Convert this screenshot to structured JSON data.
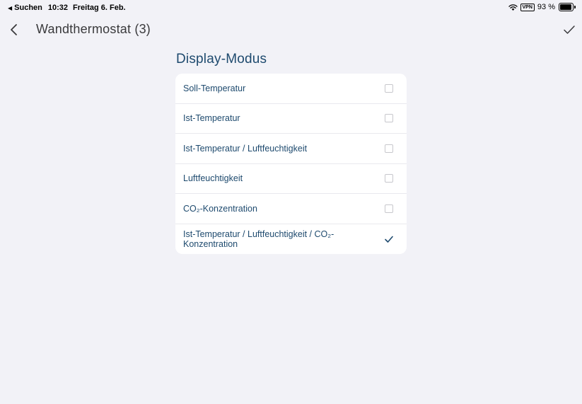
{
  "status_bar": {
    "back_app": "Suchen",
    "time": "10:32",
    "date": "Freitag 6. Feb.",
    "vpn": "VPN",
    "battery_percent": "93 %",
    "battery_level": 0.93
  },
  "nav": {
    "title": "Wandthermostat (3)"
  },
  "section": {
    "title": "Display-Modus"
  },
  "options": [
    {
      "label": "Soll-Temperatur",
      "checked": false
    },
    {
      "label": "Ist-Temperatur",
      "checked": false
    },
    {
      "label": "Ist-Temperatur / Luftfeuchtigkeit",
      "checked": false
    },
    {
      "label": "Luftfeuchtigkeit",
      "checked": false
    },
    {
      "label": "CO₂-Konzentration",
      "checked": false
    },
    {
      "label": "Ist-Temperatur / Luftfeuchtigkeit / CO₂-Konzentration",
      "checked": true
    }
  ],
  "colors": {
    "accent": "#1e4a6e",
    "background": "#f2f2f7",
    "card": "#ffffff"
  }
}
